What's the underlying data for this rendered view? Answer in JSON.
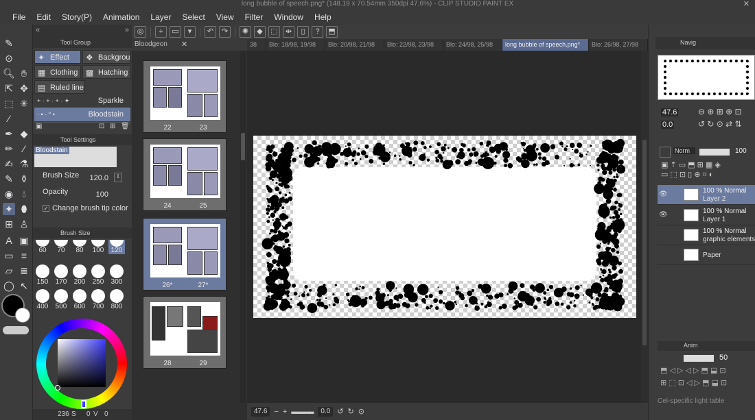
{
  "window": {
    "title": "long bubble of speech.png* (148.19 x 70.54mm 350dpi 47.6%) - CLIP STUDIO PAINT EX"
  },
  "menu": [
    "File",
    "Edit",
    "Story(P)",
    "Animation",
    "Layer",
    "Select",
    "View",
    "Filter",
    "Window",
    "Help"
  ],
  "tool_group": {
    "header": "Tool Group",
    "items": [
      "Effect",
      "Backgrour",
      "Clothing",
      "Hatching",
      "Ruled line"
    ]
  },
  "brushes": [
    "Sparkle",
    "Bloodstain"
  ],
  "tool_settings": {
    "header": "Tool Settings",
    "brush_name": "Bloodstain",
    "brush_size_label": "Brush Size",
    "brush_size_value": "120.0",
    "opacity_label": "Opacity",
    "opacity_value": "100",
    "change_tip_label": "Change brush tip color"
  },
  "brush_size_panel": {
    "header": "Brush Size",
    "sizes": [
      "60",
      "70",
      "80",
      "100",
      "120",
      "150",
      "170",
      "200",
      "250",
      "300",
      "400",
      "500",
      "600",
      "700",
      "800"
    ]
  },
  "colors": {
    "main": "#000000",
    "sub": "#ffffff",
    "accent": "#6b7ba0"
  },
  "color_status": {
    "h": "236",
    "s": "S",
    "v": "0",
    "v_label": "V",
    "b": "0"
  },
  "pages_panel": {
    "tab": "Bloodgeon",
    "spreads": [
      {
        "left": "22",
        "right": "23"
      },
      {
        "left": "24",
        "right": "25"
      },
      {
        "left": "26*",
        "right": "27*"
      },
      {
        "left": "28",
        "right": "29"
      }
    ]
  },
  "doc_tabs": [
    "38",
    "Blo: 18/98, 19/98",
    "Blo: 20/98, 21/98",
    "Blo: 22/98, 23/98",
    "Blo: 24/98, 25/98",
    "long bubble of speech.png*",
    "Blo: 26/98, 27/98"
  ],
  "status": {
    "zoom": "47.6",
    "rotation": "0.0"
  },
  "navigator": {
    "tab": "Navig",
    "zoom": "47.6",
    "rotation": "0.0"
  },
  "layer_panel": {
    "blend_mode": "Norm",
    "opacity": "100",
    "layers": [
      {
        "blend": "100 % Normal",
        "name": "Layer 2"
      },
      {
        "blend": "100 % Normal",
        "name": "Layer 1"
      },
      {
        "blend": "100 % Normal",
        "name": "graphic elements"
      },
      {
        "blend": "",
        "name": "Paper"
      }
    ]
  },
  "animation_panel": {
    "tab": "Anim",
    "value": "50"
  },
  "footer_right": "Cel-specific light table"
}
